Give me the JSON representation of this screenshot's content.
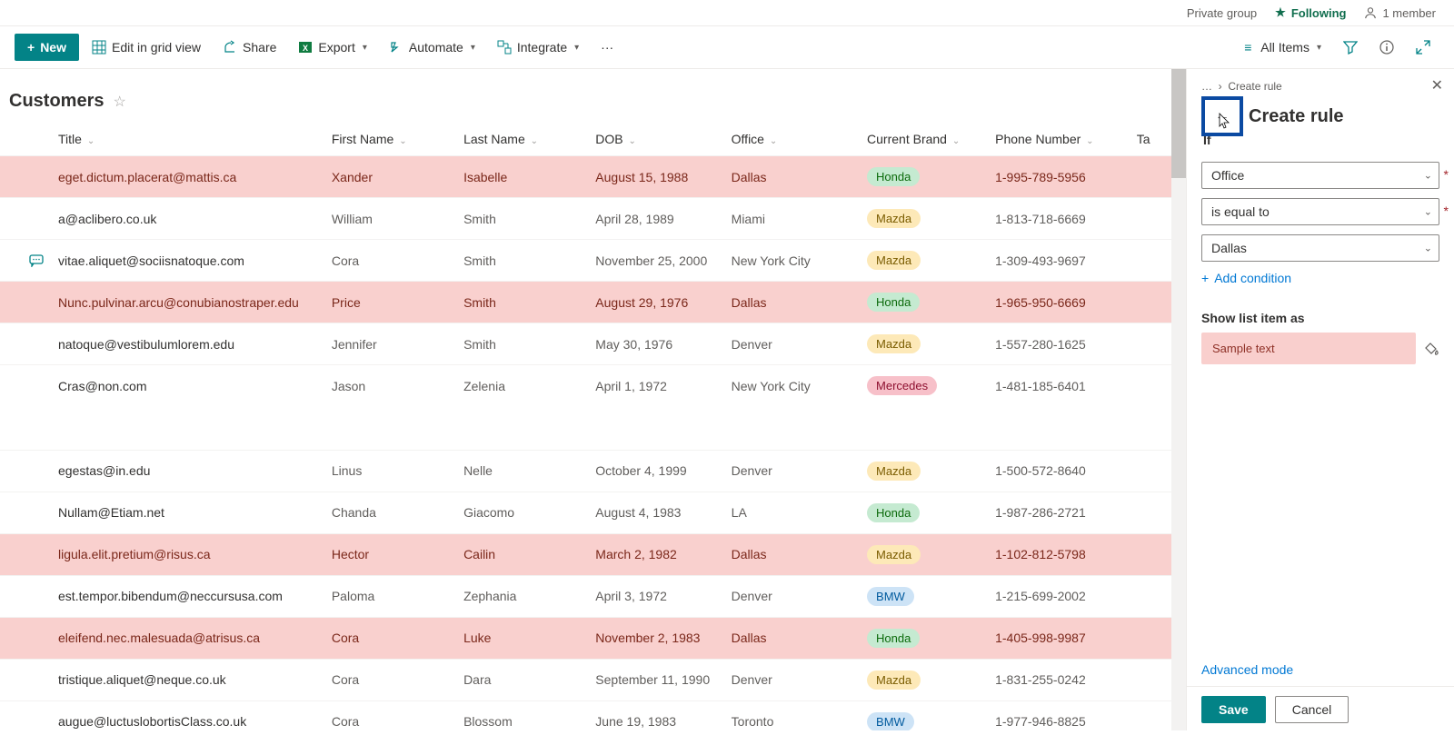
{
  "header": {
    "group_type": "Private group",
    "following": "Following",
    "members": "1 member"
  },
  "cmdbar": {
    "new": "New",
    "edit_grid": "Edit in grid view",
    "share": "Share",
    "export": "Export",
    "automate": "Automate",
    "integrate": "Integrate",
    "view_label": "All Items"
  },
  "list": {
    "title": "Customers",
    "columns": {
      "title": "Title",
      "first_name": "First Name",
      "last_name": "Last Name",
      "dob": "DOB",
      "office": "Office",
      "brand": "Current Brand",
      "phone": "Phone Number",
      "tag": "Ta"
    },
    "rows": [
      {
        "title": "eget.dictum.placerat@mattis.ca",
        "first": "Xander",
        "last": "Isabelle",
        "dob": "August 15, 1988",
        "office": "Dallas",
        "brand": "Honda",
        "brand_class": "honda",
        "phone": "1-995-789-5956",
        "hl": true
      },
      {
        "title": "a@aclibero.co.uk",
        "first": "William",
        "last": "Smith",
        "dob": "April 28, 1989",
        "office": "Miami",
        "brand": "Mazda",
        "brand_class": "mazda",
        "phone": "1-813-718-6669"
      },
      {
        "title": "vitae.aliquet@sociisnatoque.com",
        "first": "Cora",
        "last": "Smith",
        "dob": "November 25, 2000",
        "office": "New York City",
        "brand": "Mazda",
        "brand_class": "mazda",
        "phone": "1-309-493-9697",
        "comment": true
      },
      {
        "title": "Nunc.pulvinar.arcu@conubianostraper.edu",
        "first": "Price",
        "last": "Smith",
        "dob": "August 29, 1976",
        "office": "Dallas",
        "brand": "Honda",
        "brand_class": "honda",
        "phone": "1-965-950-6669",
        "hl": true
      },
      {
        "title": "natoque@vestibulumlorem.edu",
        "first": "Jennifer",
        "last": "Smith",
        "dob": "May 30, 1976",
        "office": "Denver",
        "brand": "Mazda",
        "brand_class": "mazda",
        "phone": "1-557-280-1625"
      },
      {
        "title": "Cras@non.com",
        "first": "Jason",
        "last": "Zelenia",
        "dob": "April 1, 1972",
        "office": "New York City",
        "brand": "Mercedes",
        "brand_class": "mercedes",
        "phone": "1-481-185-6401"
      },
      {
        "gap": true
      },
      {
        "title": "egestas@in.edu",
        "first": "Linus",
        "last": "Nelle",
        "dob": "October 4, 1999",
        "office": "Denver",
        "brand": "Mazda",
        "brand_class": "mazda",
        "phone": "1-500-572-8640"
      },
      {
        "title": "Nullam@Etiam.net",
        "first": "Chanda",
        "last": "Giacomo",
        "dob": "August 4, 1983",
        "office": "LA",
        "brand": "Honda",
        "brand_class": "honda",
        "phone": "1-987-286-2721"
      },
      {
        "title": "ligula.elit.pretium@risus.ca",
        "first": "Hector",
        "last": "Cailin",
        "dob": "March 2, 1982",
        "office": "Dallas",
        "brand": "Mazda",
        "brand_class": "mazda",
        "phone": "1-102-812-5798",
        "hl": true
      },
      {
        "title": "est.tempor.bibendum@neccursusa.com",
        "first": "Paloma",
        "last": "Zephania",
        "dob": "April 3, 1972",
        "office": "Denver",
        "brand": "BMW",
        "brand_class": "bmw",
        "phone": "1-215-699-2002"
      },
      {
        "title": "eleifend.nec.malesuada@atrisus.ca",
        "first": "Cora",
        "last": "Luke",
        "dob": "November 2, 1983",
        "office": "Dallas",
        "brand": "Honda",
        "brand_class": "honda",
        "phone": "1-405-998-9987",
        "hl": true
      },
      {
        "title": "tristique.aliquet@neque.co.uk",
        "first": "Cora",
        "last": "Dara",
        "dob": "September 11, 1990",
        "office": "Denver",
        "brand": "Mazda",
        "brand_class": "mazda",
        "phone": "1-831-255-0242"
      },
      {
        "title": "augue@luctuslobortisClass.co.uk",
        "first": "Cora",
        "last": "Blossom",
        "dob": "June 19, 1983",
        "office": "Toronto",
        "brand": "BMW",
        "brand_class": "bmw",
        "phone": "1-977-946-8825"
      }
    ]
  },
  "panel": {
    "crumb_root": "…",
    "crumb_leaf": "Create rule",
    "title": "Create rule",
    "if_label": "If",
    "column_value": "Office",
    "operator_value": "is equal to",
    "value_value": "Dallas",
    "add_condition": "Add condition",
    "show_as_label": "Show list item as",
    "sample_text": "Sample text",
    "advanced": "Advanced mode",
    "save": "Save",
    "cancel": "Cancel"
  }
}
